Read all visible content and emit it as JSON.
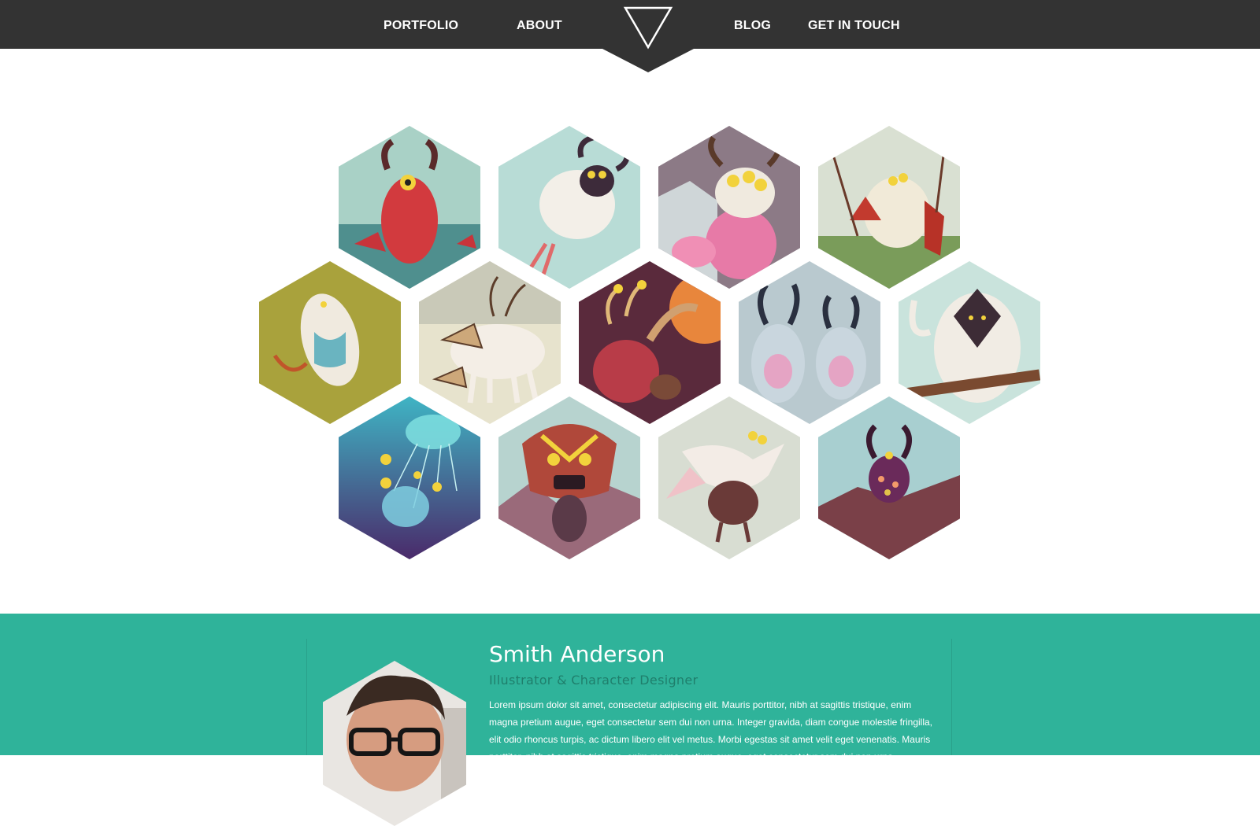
{
  "nav": {
    "items": [
      "PORTFOLIO",
      "ABOUT",
      "BLOG",
      "GET IN TOUCH"
    ]
  },
  "gallery": {
    "tiles": [
      {
        "name": "red-horned-monster-illustration"
      },
      {
        "name": "floating-sheep-monster-illustration"
      },
      {
        "name": "pink-cow-monster-illustration"
      },
      {
        "name": "puppet-creature-illustration"
      },
      {
        "name": "sleeping-creature-illustration"
      },
      {
        "name": "white-deer-creature-illustration"
      },
      {
        "name": "tentacle-monster-illustration"
      },
      {
        "name": "yeti-pair-illustration"
      },
      {
        "name": "hooded-yeti-illustration"
      },
      {
        "name": "jellyfish-illustration"
      },
      {
        "name": "tribal-mask-monster-illustration"
      },
      {
        "name": "white-bird-creature-illustration"
      },
      {
        "name": "purple-horned-creature-illustration"
      }
    ]
  },
  "about": {
    "name": "Smith Anderson",
    "role": "Illustrator & Character Designer",
    "bio": "Lorem ipsum dolor sit amet, consectetur adipiscing elit. Mauris porttitor, nibh at sagittis tristique, enim magna pretium augue, eget consectetur sem dui non urna. Integer gravida, diam congue molestie fringilla, elit odio rhoncus turpis, ac dictum libero elit vel metus. Morbi egestas sit amet velit eget venenatis. Mauris porttitor, nibh at sagittis tristique, enim magna pretium augue, eget consectetur sem dui non urna."
  },
  "colors": {
    "nav_bg": "#333333",
    "accent": "#2fb39a",
    "nav_text": "#ffffff"
  }
}
